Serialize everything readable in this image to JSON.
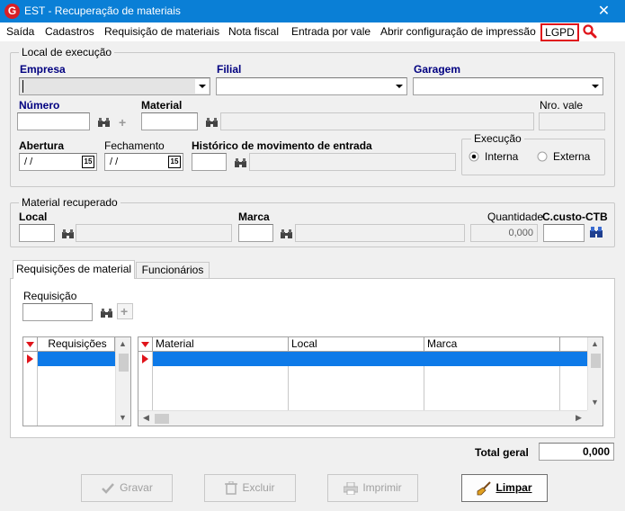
{
  "window": {
    "title": "EST - Recuperação de materiais",
    "close": "✕",
    "app_icon": "G"
  },
  "menu": {
    "items": [
      "Saída",
      "Cadastros",
      "Requisição de materiais",
      "Nota fiscal",
      "Entrada por vale",
      "Abrir configuração de impressão"
    ],
    "lgpd": "LGPD"
  },
  "local": {
    "group_label": "Local de execução",
    "empresa_label": "Empresa",
    "filial_label": "Filial",
    "garagem_label": "Garagem",
    "numero_label": "Número",
    "material_label": "Material",
    "nro_vale_label": "Nro. vale",
    "abertura_label": "Abertura",
    "abertura_value": "/ /",
    "fechamento_label": "Fechamento",
    "fechamento_value": "/ /",
    "historico_label": "Histórico de movimento de entrada",
    "calendar_glyph": "15"
  },
  "execucao": {
    "label": "Execução",
    "interna": "Interna",
    "externa": "Externa",
    "selected": "Interna"
  },
  "recuperado": {
    "group_label": "Material recuperado",
    "local_label": "Local",
    "marca_label": "Marca",
    "quantidade_label": "Quantidade",
    "quantidade_value": "0,000",
    "ccusto_label": "C.custo-CTB"
  },
  "tabs": {
    "requisicoes": "Requisições de material",
    "funcionarios": "Funcionários",
    "active": "Requisições de material"
  },
  "requisicao": {
    "label": "Requisição"
  },
  "grid_left": {
    "columns": [
      "Requisições"
    ]
  },
  "grid_right": {
    "columns": [
      "Material",
      "Local",
      "Marca"
    ]
  },
  "total": {
    "label": "Total geral",
    "value": "0,000"
  },
  "buttons": {
    "gravar": "Gravar",
    "excluir": "Excluir",
    "imprimir": "Imprimir",
    "limpar": "Limpar"
  },
  "colors": {
    "title_bar": "#0a7fd6",
    "selection": "#0e7ae8",
    "lgpd_border": "#e0141b",
    "field_label": "#000080"
  }
}
